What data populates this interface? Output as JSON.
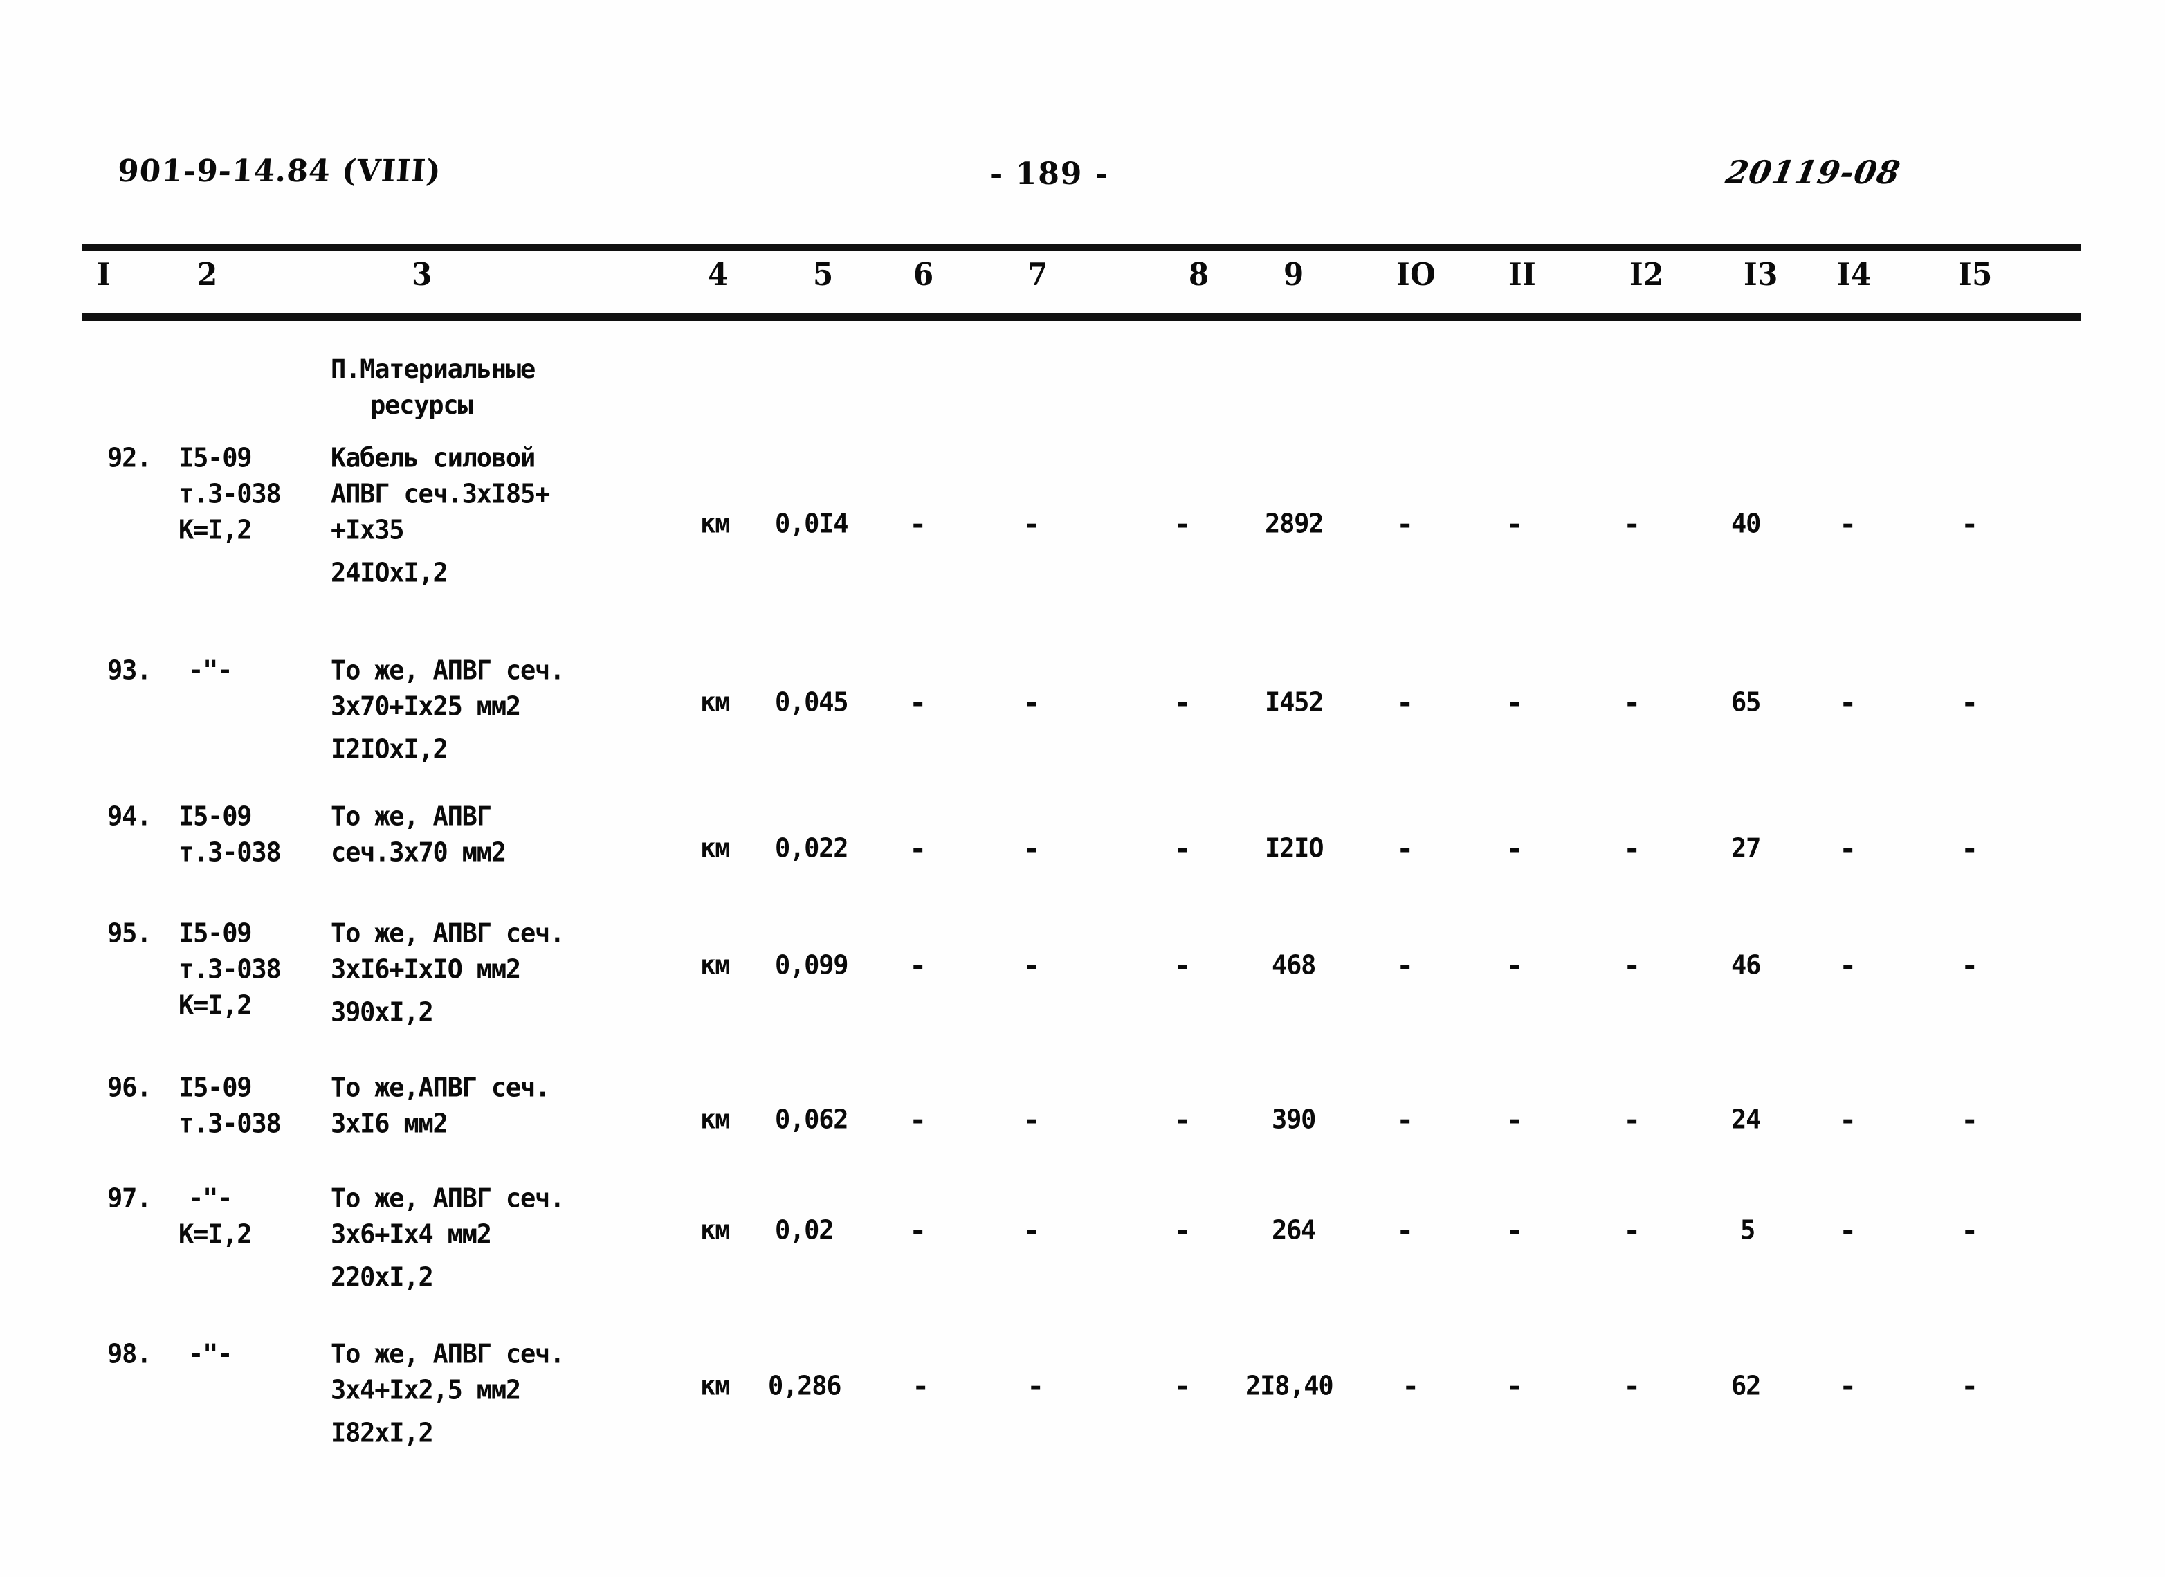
{
  "document": {
    "header_left": "901-9-14.84 (VIII)",
    "page_number": "- 189 -",
    "header_right": "20119-08"
  },
  "table": {
    "column_headers": [
      "I",
      "2",
      "3",
      "4",
      "5",
      "6",
      "7",
      "8",
      "9",
      "IO",
      "II",
      "I2",
      "I3",
      "I4",
      "I5"
    ],
    "section_title_line1": "П.Материальные",
    "section_title_line2": "ресурсы",
    "rows": [
      {
        "num": "92.",
        "code_lines": [
          "I5-09",
          "т.3-038",
          "К=I,2"
        ],
        "name_lines": [
          "Кабель силовой",
          "АПВГ сеч.3хI85+",
          "+Iх35"
        ],
        "name_extra": "24IOхI,2",
        "unit": "км",
        "c5": "0,0I4",
        "c6": "-",
        "c7": "-",
        "c8": "-",
        "c9": "2892",
        "c10": "-",
        "c11": "-",
        "c12": "-",
        "c13": "40",
        "c14": "-",
        "c15": "-"
      },
      {
        "num": "93.",
        "code_lines": [
          "-\"-"
        ],
        "name_lines": [
          "То же, АПВГ сеч.",
          "3х70+Iх25 мм2"
        ],
        "name_extra": "I2IOхI,2",
        "unit": "км",
        "c5": "0,045",
        "c6": "-",
        "c7": "-",
        "c8": "-",
        "c9": "I452",
        "c10": "-",
        "c11": "-",
        "c12": "-",
        "c13": "65",
        "c14": "-",
        "c15": "-"
      },
      {
        "num": "94.",
        "code_lines": [
          "I5-09",
          "т.3-038"
        ],
        "name_lines": [
          "То же, АПВГ",
          "сеч.3х70 мм2"
        ],
        "name_extra": "",
        "unit": "км",
        "c5": "0,022",
        "c6": "-",
        "c7": "-",
        "c8": "-",
        "c9": "I2IO",
        "c10": "-",
        "c11": "-",
        "c12": "-",
        "c13": "27",
        "c14": "-",
        "c15": "-"
      },
      {
        "num": "95.",
        "code_lines": [
          "I5-09",
          "т.3-038",
          "К=I,2"
        ],
        "name_lines": [
          "То же, АПВГ сеч.",
          "3хI6+IхIO мм2"
        ],
        "name_extra": "390хI,2",
        "unit": "км",
        "c5": "0,099",
        "c6": "-",
        "c7": "-",
        "c8": "-",
        "c9": "468",
        "c10": "-",
        "c11": "-",
        "c12": "-",
        "c13": "46",
        "c14": "-",
        "c15": "-"
      },
      {
        "num": "96.",
        "code_lines": [
          "I5-09",
          "т.3-038"
        ],
        "name_lines": [
          "То же,АПВГ сеч.",
          "3хI6 мм2"
        ],
        "name_extra": "",
        "unit": "км",
        "c5": "0,062",
        "c6": "-",
        "c7": "-",
        "c8": "-",
        "c9": "390",
        "c10": "-",
        "c11": "-",
        "c12": "-",
        "c13": "24",
        "c14": "-",
        "c15": "-"
      },
      {
        "num": "97.",
        "code_lines": [
          "-\"-",
          "К=I,2"
        ],
        "name_lines": [
          "То же, АПВГ сеч.",
          "3х6+Iх4 мм2"
        ],
        "name_extra": "220хI,2",
        "unit": "км",
        "c5": "0,02",
        "c6": "-",
        "c7": "-",
        "c8": "-",
        "c9": "264",
        "c10": "-",
        "c11": "-",
        "c12": "-",
        "c13": "5",
        "c14": "-",
        "c15": "-"
      },
      {
        "num": "98.",
        "code_lines": [
          "-\"-"
        ],
        "name_lines": [
          "То же, АПВГ сеч.",
          "3х4+Iх2,5 мм2"
        ],
        "name_extra": "I82хI,2",
        "unit": "км",
        "c5": "0,286",
        "c6": "-",
        "c7": "-",
        "c8": "-",
        "c9": "2I8,40",
        "c10": "-",
        "c11": "-",
        "c12": "-",
        "c13": "62",
        "c14": "-",
        "c15": "-"
      }
    ]
  }
}
